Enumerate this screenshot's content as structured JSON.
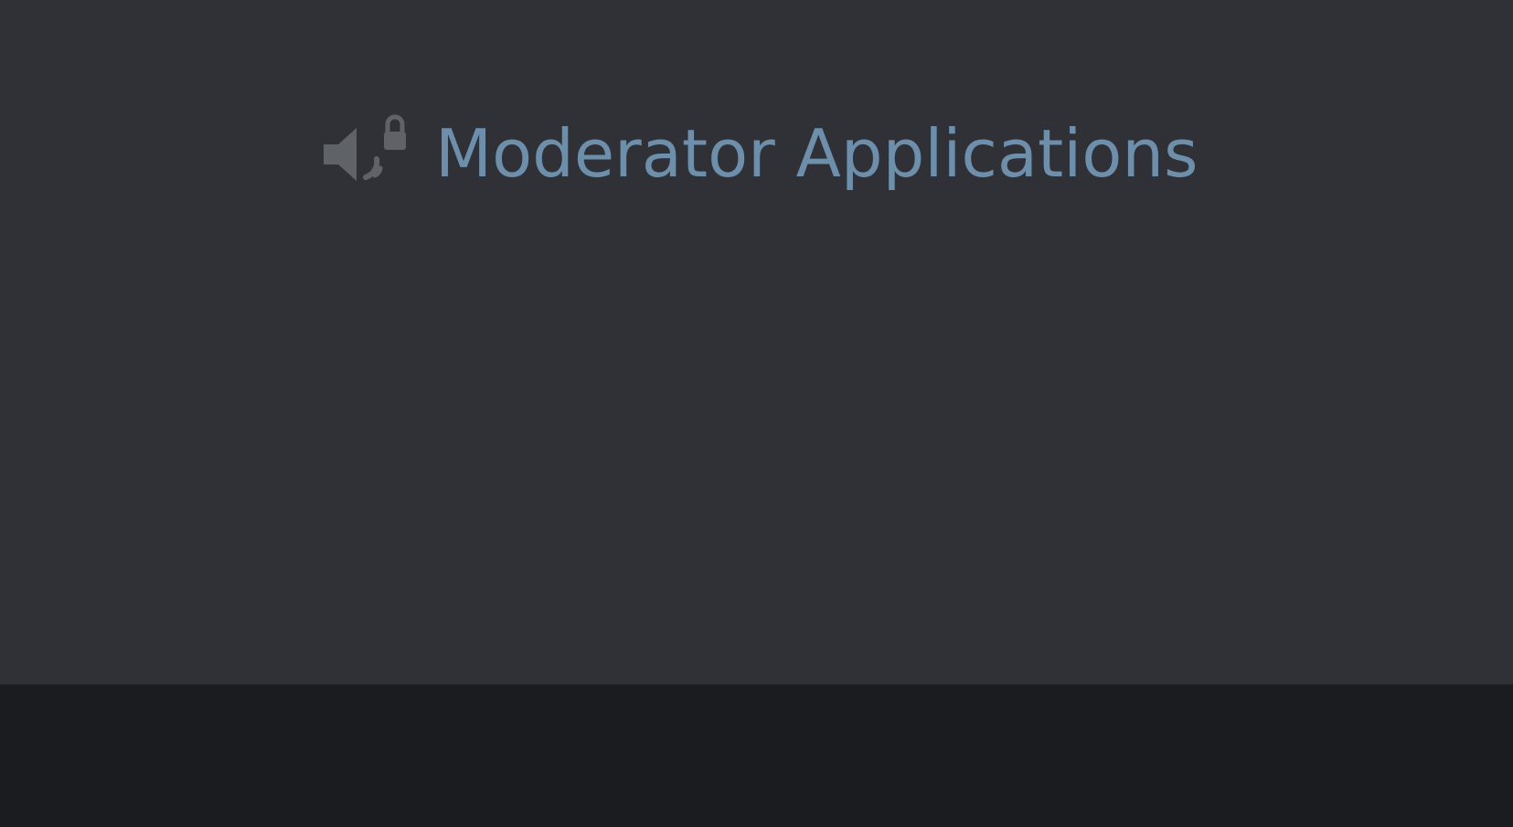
{
  "channel": {
    "name": "Moderator Applications",
    "icon": "locked-voice-channel-icon",
    "text_color": "#6d8fab",
    "icon_color": "#5f6368"
  },
  "colors": {
    "background": "#2f3136",
    "bottom_bar": "#1b1c1f"
  }
}
